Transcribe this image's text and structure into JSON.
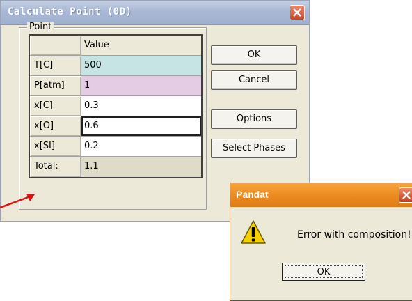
{
  "main_dialog": {
    "title": "Calculate Point (0D)",
    "group_label": "Point",
    "grid": {
      "header": {
        "col1": "",
        "col2": "Value"
      },
      "rows": [
        {
          "label": "T[C]",
          "value": "500"
        },
        {
          "label": "P[atm]",
          "value": "1"
        },
        {
          "label": "x[C]",
          "value": "0.3"
        },
        {
          "label": "x[O]",
          "value": "0.6"
        },
        {
          "label": "x[SI]",
          "value": "0.2"
        },
        {
          "label": "Total:",
          "value": "1.1"
        }
      ]
    },
    "buttons": {
      "ok": "OK",
      "cancel": "Cancel",
      "options": "Options",
      "select_phases": "Select Phases"
    }
  },
  "error_dialog": {
    "title": "Pandat",
    "message": "Error with composition!",
    "ok": "OK"
  },
  "colors": {
    "title_blue": "#a9b8d4",
    "error_title_orange": "#eb8a20",
    "row_teal": "#c6e4e4",
    "row_pink": "#e4cce4",
    "arrow_red": "#e01010"
  },
  "icons": [
    "close-icon",
    "warning-icon"
  ]
}
